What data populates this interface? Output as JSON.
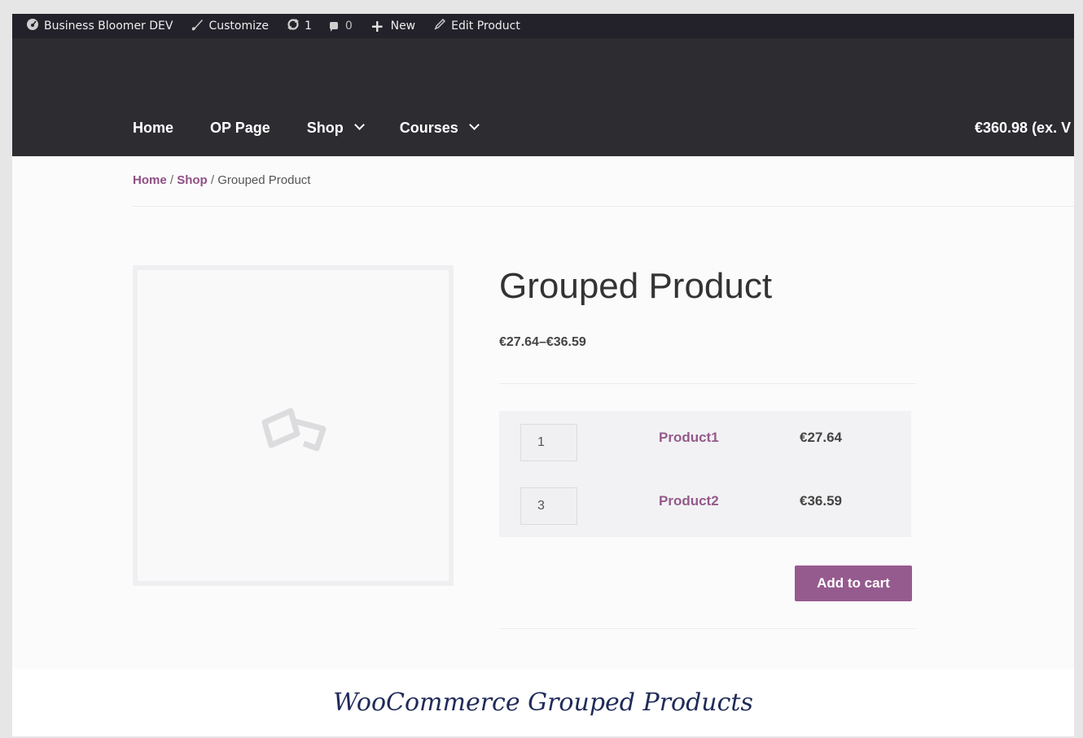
{
  "admin_bar": {
    "site_name": "Business Bloomer DEV",
    "customize": "Customize",
    "updates_count": "1",
    "comments_count": "0",
    "new": "New",
    "edit_product": "Edit Product"
  },
  "nav": {
    "items": [
      {
        "label": "Home",
        "has_dropdown": false
      },
      {
        "label": "OP Page",
        "has_dropdown": false
      },
      {
        "label": "Shop",
        "has_dropdown": true
      },
      {
        "label": "Courses",
        "has_dropdown": true
      }
    ],
    "cart_total": "€360.98 (ex. V"
  },
  "breadcrumb": {
    "home": "Home",
    "sep1": " / ",
    "shop": "Shop",
    "sep2": " / ",
    "current": "Grouped Product"
  },
  "product": {
    "title": "Grouped Product",
    "price_range": "€27.64–€36.59",
    "items": [
      {
        "qty": "1",
        "name": "Product1",
        "price": "€27.64"
      },
      {
        "qty": "3",
        "name": "Product2",
        "price": "€36.59"
      }
    ],
    "add_to_cart": "Add to cart"
  },
  "caption": "WooCommerce Grouped Products",
  "colors": {
    "accent": "#965b8e",
    "header_bg": "#2d2c31",
    "admin_bar_bg": "#23222a",
    "caption_text": "#1f2b58"
  }
}
